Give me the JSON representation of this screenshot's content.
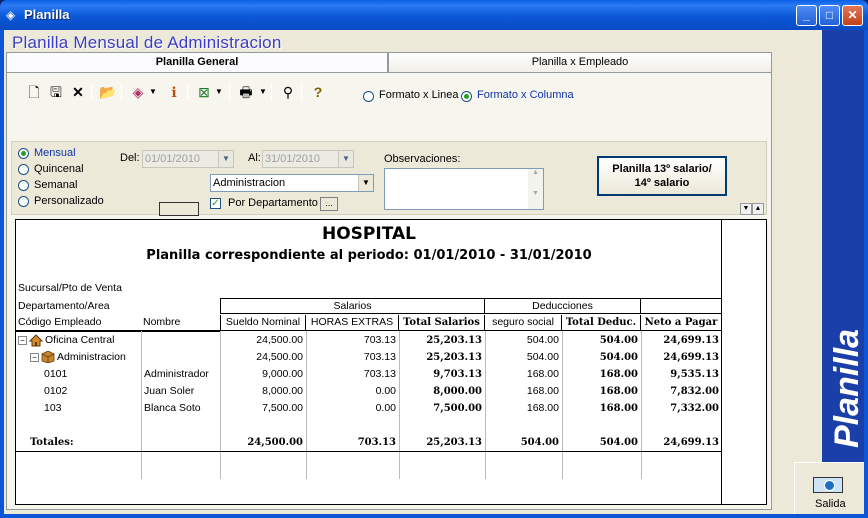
{
  "window": {
    "title": "Planilla",
    "min": "_",
    "max": "□",
    "close": "✕"
  },
  "app_title": "Planilla Mensual de Administracion",
  "side_title": "Planilla",
  "salida_label": "Salida",
  "tabs": [
    {
      "label": "Planilla General"
    },
    {
      "label": "Planilla x Empleado"
    }
  ],
  "toolbar": {
    "format_linea": "Formato x Linea",
    "format_columna": "Formato x Columna",
    "selected_format": "columna"
  },
  "filter": {
    "periods": [
      "Mensual",
      "Quincenal",
      "Semanal",
      "Personalizado"
    ],
    "selected_period": "Mensual",
    "del_label": "Del:",
    "del_value": "01/01/2010",
    "al_label": "Al:",
    "al_value": "31/01/2010",
    "observaciones_label": "Observaciones:",
    "area_value": "Administracion",
    "por_departamento_label": "Por Departamento",
    "por_departamento_checked": true,
    "ellipsis": "...",
    "btn13_line1": "Planilla 13º salario/",
    "btn13_line2": "14º salario"
  },
  "report": {
    "title": "HOSPITAL",
    "subtitle": "Planilla correspondiente al periodo: 01/01/2010 - 31/01/2010",
    "label_sucursal": "Sucursal/Pto de Venta",
    "label_departamento": "Departamento/Area",
    "group_salarios": "Salarios",
    "group_deducciones": "Deducciones",
    "columns": [
      "Código Empleado",
      "Nombre",
      "Sueldo Nominal",
      "HORAS EXTRAS",
      "Total Salarios",
      "seguro social",
      "Total Deduc.",
      "Neto a Pagar"
    ],
    "rows": [
      {
        "code": "Oficina Central",
        "nombre": "",
        "sueldo": "24,500.00",
        "horas": "703.13",
        "total_sal": "25,203.13",
        "seguro": "504.00",
        "total_ded": "504.00",
        "neto": "24,699.13",
        "kind": "sucursal"
      },
      {
        "code": "Administracion",
        "nombre": "",
        "sueldo": "24,500.00",
        "horas": "703.13",
        "total_sal": "25,203.13",
        "seguro": "504.00",
        "total_ded": "504.00",
        "neto": "24,699.13",
        "kind": "depto"
      },
      {
        "code": "0101",
        "nombre": "Administrador",
        "sueldo": "9,000.00",
        "horas": "703.13",
        "total_sal": "9,703.13",
        "seguro": "168.00",
        "total_ded": "168.00",
        "neto": "9,535.13",
        "kind": "emp"
      },
      {
        "code": "0102",
        "nombre": "Juan Soler",
        "sueldo": "8,000.00",
        "horas": "0.00",
        "total_sal": "8,000.00",
        "seguro": "168.00",
        "total_ded": "168.00",
        "neto": "7,832.00",
        "kind": "emp"
      },
      {
        "code": "103",
        "nombre": "Blanca Soto",
        "sueldo": "7,500.00",
        "horas": "0.00",
        "total_sal": "7,500.00",
        "seguro": "168.00",
        "total_ded": "168.00",
        "neto": "7,332.00",
        "kind": "emp"
      }
    ],
    "totals": {
      "label": "Totales:",
      "sueldo": "24,500.00",
      "horas": "703.13",
      "total_sal": "25,203.13",
      "seguro": "504.00",
      "total_ded": "504.00",
      "neto": "24,699.13"
    }
  }
}
